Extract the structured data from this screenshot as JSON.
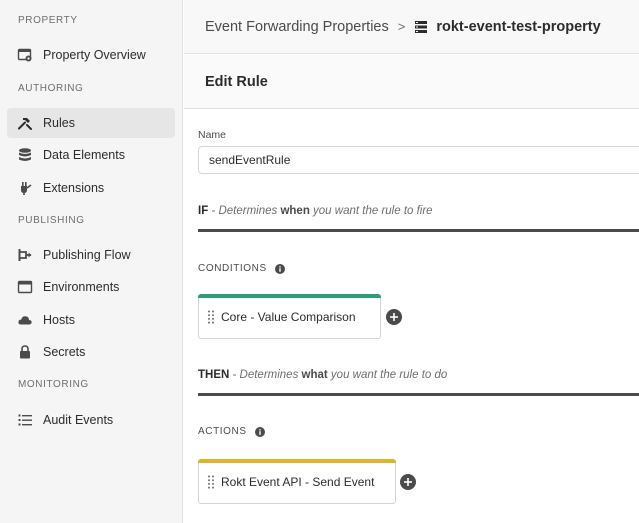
{
  "sidebar": {
    "sections": {
      "property": "PROPERTY",
      "authoring": "AUTHORING",
      "publishing": "PUBLISHING",
      "monitoring": "MONITORING"
    },
    "items": {
      "property_overview": "Property Overview",
      "rules": "Rules",
      "data_elements": "Data Elements",
      "extensions": "Extensions",
      "publishing_flow": "Publishing Flow",
      "environments": "Environments",
      "hosts": "Hosts",
      "secrets": "Secrets",
      "audit_events": "Audit Events"
    },
    "selected": "Rules"
  },
  "header": {
    "breadcrumb_parent": "Event Forwarding Properties",
    "breadcrumb_separator": ">",
    "breadcrumb_current": "rokt-event-test-property"
  },
  "edit_bar": {
    "title": "Edit Rule"
  },
  "form": {
    "name_label": "Name",
    "name_value": "sendEventRule"
  },
  "if_phase": {
    "keyword": "IF",
    "prefix": " - Determines ",
    "emphasis": "when",
    "suffix": " you want the rule to fire"
  },
  "conditions": {
    "title": "CONDITIONS",
    "card_label": "Core - Value Comparison",
    "stripe_color": "#2d9d78"
  },
  "then_phase": {
    "keyword": "THEN",
    "prefix": " - Determines ",
    "emphasis": "what",
    "suffix": " you want the rule to do"
  },
  "actions": {
    "title": "ACTIONS",
    "card_label": "Rokt Event API - Send Event",
    "stripe_color": "#e0b42a"
  },
  "colors": {
    "sidebar_bg": "#f5f5f5",
    "selected_bg": "#e6e6e6",
    "phase_rule": "#4b4b4b"
  }
}
